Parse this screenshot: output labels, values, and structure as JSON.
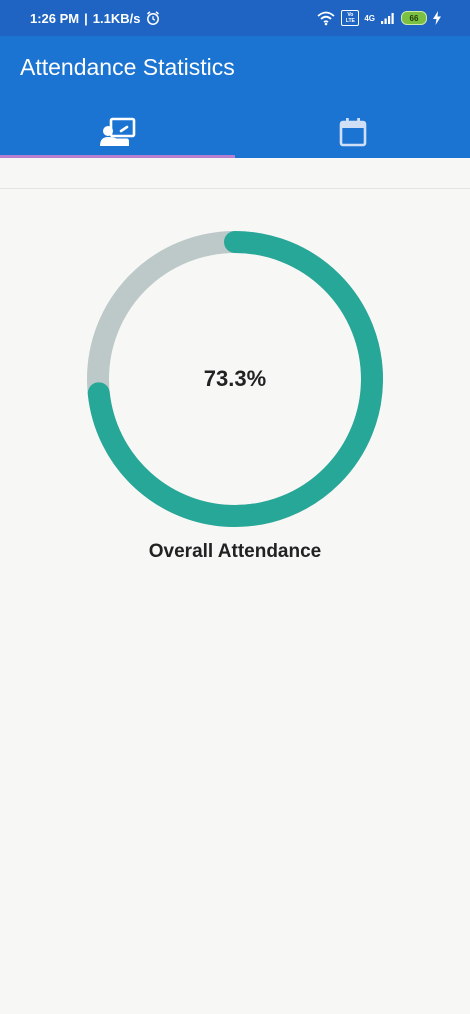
{
  "status_bar": {
    "time": "1:26 PM",
    "separator": "|",
    "network_speed": "1.1KB/s",
    "volte_label": "Vo LTE",
    "network_type": "4G",
    "battery": "66",
    "icons": [
      "alarm-icon",
      "wifi-icon",
      "volte-icon",
      "signal-icon",
      "battery-icon",
      "charging-icon"
    ]
  },
  "app_bar": {
    "title": "Attendance Statistics",
    "tabs": [
      {
        "icon": "classroom-icon",
        "selected": true
      },
      {
        "icon": "calendar-icon",
        "selected": false
      }
    ]
  },
  "colors": {
    "status_bar": "#1f64c2",
    "app_bar": "#1c74d2",
    "tab_indicator": "#b77fd0",
    "progress": "#26a797",
    "track": "#bcc9c8",
    "background": "#f7f8f6"
  },
  "chart_data": {
    "type": "pie",
    "title": "Overall Attendance",
    "center_label": "73.3%",
    "values": [
      73.3,
      26.7
    ],
    "colors": [
      "#26a797",
      "#bcc9c8"
    ]
  }
}
